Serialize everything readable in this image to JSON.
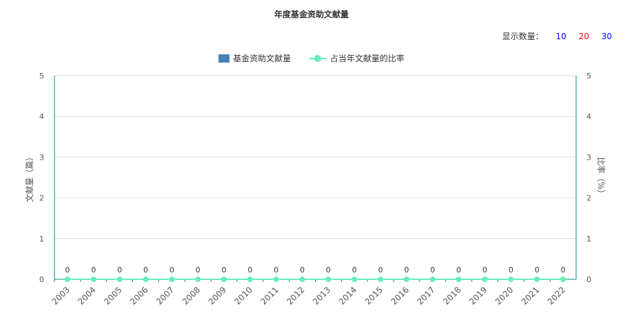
{
  "chart_data": {
    "type": "bar+line",
    "title": "年度基金资助文献量",
    "categories": [
      "2003",
      "2004",
      "2005",
      "2006",
      "2007",
      "2008",
      "2009",
      "2010",
      "2011",
      "2012",
      "2013",
      "2014",
      "2015",
      "2016",
      "2017",
      "2018",
      "2019",
      "2020",
      "2021",
      "2022"
    ],
    "series": [
      {
        "name": "基金资助文献量",
        "type": "bar",
        "axis": "left",
        "values": [
          0,
          0,
          0,
          0,
          0,
          0,
          0,
          0,
          0,
          0,
          0,
          0,
          0,
          0,
          0,
          0,
          0,
          0,
          0,
          0
        ]
      },
      {
        "name": "占当年文献量的比率",
        "type": "line",
        "axis": "right",
        "values": [
          0,
          0,
          0,
          0,
          0,
          0,
          0,
          0,
          0,
          0,
          0,
          0,
          0,
          0,
          0,
          0,
          0,
          0,
          0,
          0
        ]
      }
    ],
    "ylabel": "文献量（篇）",
    "ylabel_right": "比率（%）",
    "ylim": [
      0,
      5
    ],
    "ylim_right": [
      0,
      5
    ],
    "yticks": [
      0,
      1,
      2,
      3,
      4,
      5
    ],
    "grid": true,
    "legend": "top-center",
    "colors": {
      "bar": "#4682b4",
      "line": "#66eebb",
      "axis": "#008b8b",
      "grid": "#dddddd",
      "text": "#555555"
    }
  },
  "controls": {
    "count_label": "显示数量：",
    "options": [
      {
        "label": "10",
        "color": "#0000ff"
      },
      {
        "label": "20",
        "color": "#ff0000"
      },
      {
        "label": "30",
        "color": "#0000ff"
      }
    ]
  }
}
